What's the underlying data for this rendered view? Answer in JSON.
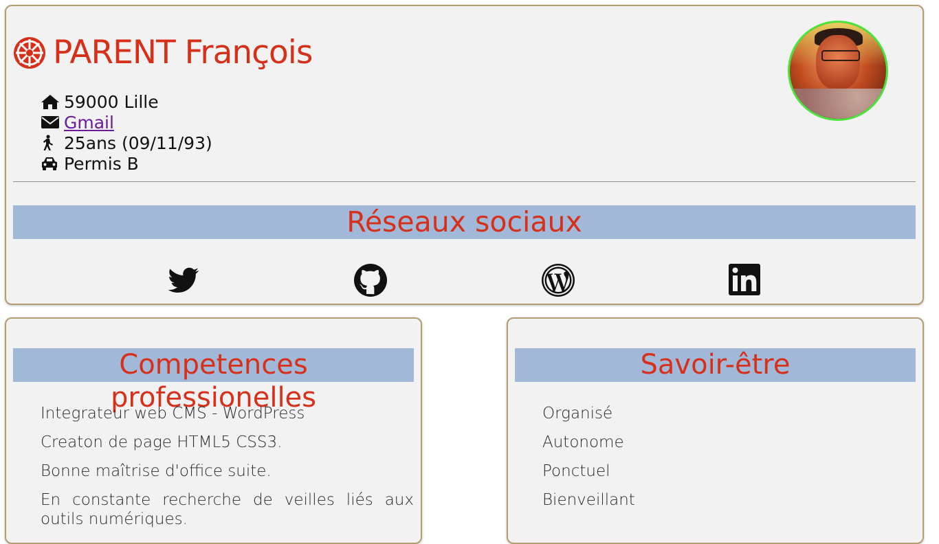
{
  "header": {
    "name": "PARENT François",
    "info": [
      {
        "icon": "home-icon",
        "text": "59000 Lille"
      },
      {
        "icon": "envelope-icon",
        "text": "Gmail",
        "link": true
      },
      {
        "icon": "walking-icon",
        "text": "25ans (09/11/93)"
      },
      {
        "icon": "car-icon",
        "text": "Permis B"
      }
    ]
  },
  "social": {
    "title": "Réseaux sociaux",
    "links": [
      "twitter-icon",
      "github-icon",
      "wordpress-icon",
      "linkedin-icon"
    ]
  },
  "skills": {
    "title": "Competences professionelles",
    "items": [
      "Integrateur web CMS - WordPress",
      "Creaton de page HTML5 CSS3.",
      "Bonne maîtrise d'office suite.",
      "En constante recherche de veilles liés aux outils numériques."
    ]
  },
  "soft_skills": {
    "title": "Savoir-être",
    "items": [
      "Organisé",
      "Autonome",
      "Ponctuel",
      "Bienveillant"
    ]
  },
  "colors": {
    "accent": "#d7301a",
    "section_bg": "#a2b8d9",
    "card_bg": "#f2f2f2",
    "card_border": "#b59d72",
    "avatar_border": "#49e43c",
    "link": "#6a1b9a"
  }
}
